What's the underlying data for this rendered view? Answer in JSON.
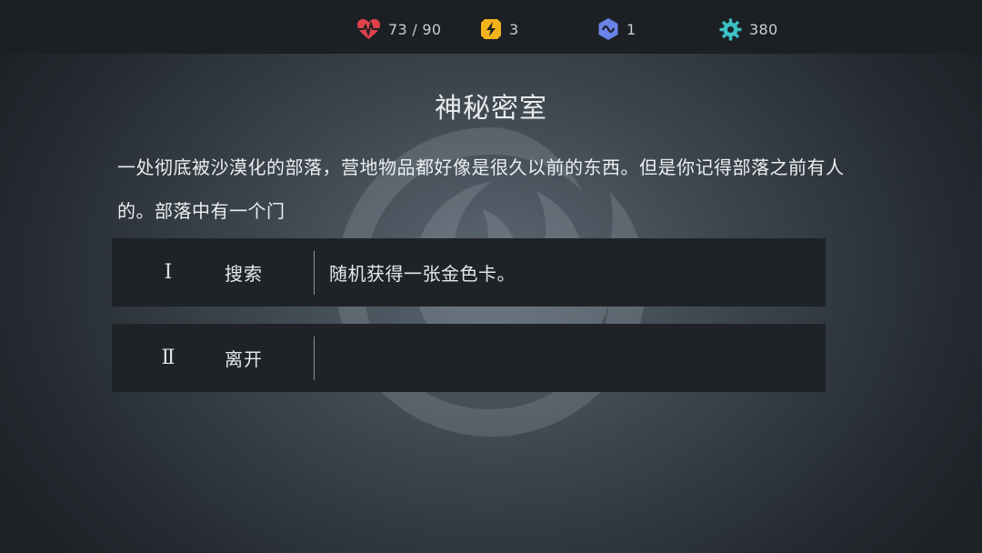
{
  "status_bar": {
    "health": {
      "icon": "heart-pulse-icon",
      "value": "73 / 90",
      "color": "#e0414b"
    },
    "energy": {
      "icon": "lightning-icon",
      "value": "3",
      "color": "#f2b21b"
    },
    "shield": {
      "icon": "wave-shield-icon",
      "value": "1",
      "color": "#6b82e8"
    },
    "gear": {
      "icon": "gear-icon",
      "value": "380",
      "color": "#3cc0c4"
    }
  },
  "event": {
    "title": "神秘密室",
    "description": "一处彻底被沙漠化的部落，营地物品都好像是很久以前的东西。但是你记得部落之前有人的。部落中有一个门"
  },
  "choices": [
    {
      "numeral": "Ⅰ",
      "label": "搜索",
      "result": "随机获得一张金色卡。"
    },
    {
      "numeral": "Ⅱ",
      "label": "离开",
      "result": ""
    }
  ]
}
